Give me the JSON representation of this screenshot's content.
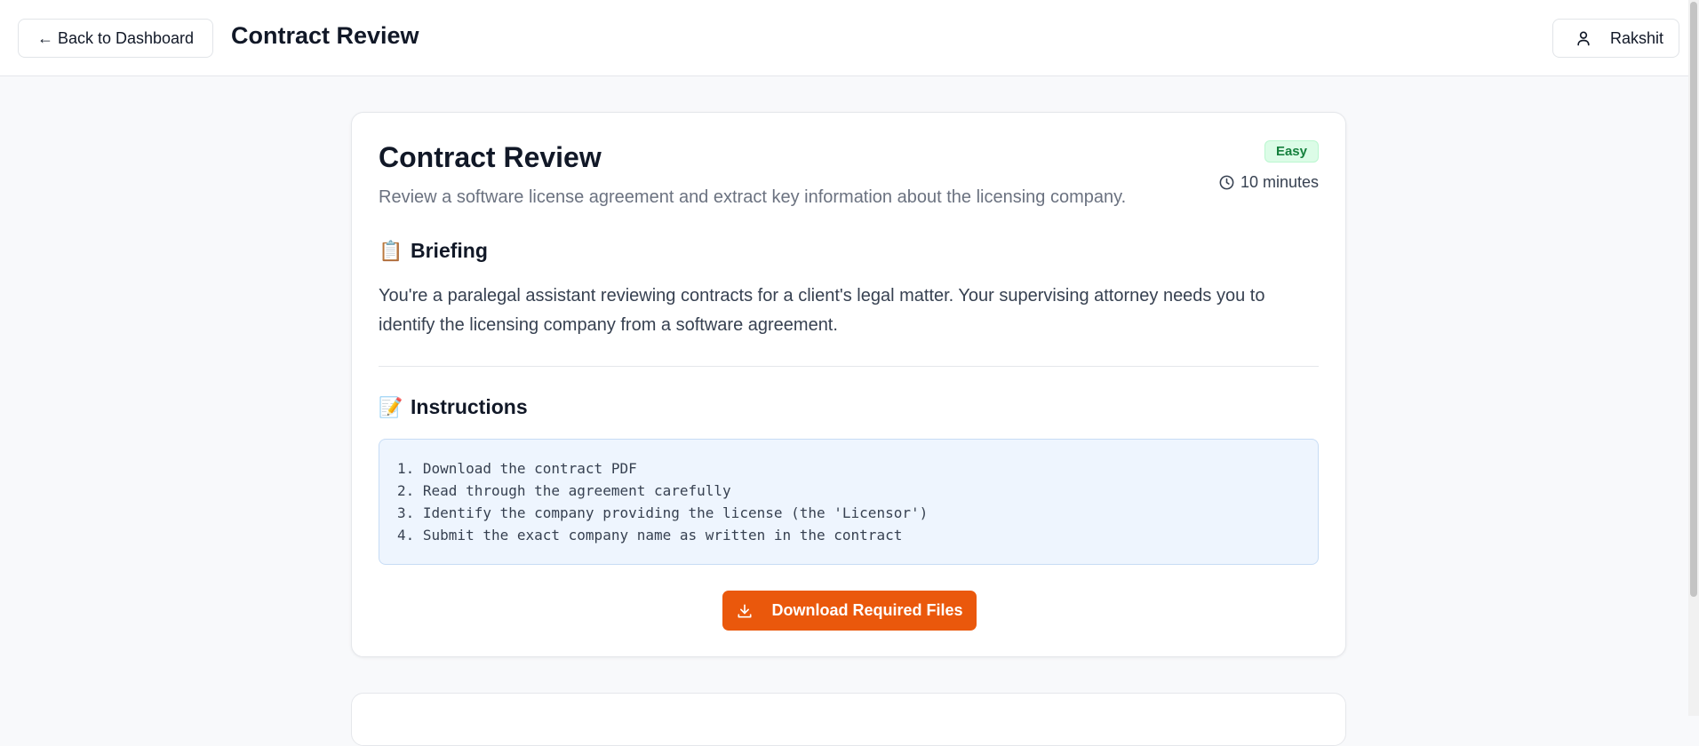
{
  "header": {
    "back_label": "← Back to Dashboard",
    "title": "Contract Review",
    "user_name": "Rakshit",
    "user_icon": "user-icon"
  },
  "task": {
    "title": "Contract Review",
    "description": "Review a software license agreement and extract key information about the licensing company.",
    "difficulty": "Easy",
    "duration": "10 minutes",
    "duration_icon": "clock-icon"
  },
  "briefing": {
    "emoji": "📋",
    "heading": "Briefing",
    "text": "You're a paralegal assistant reviewing contracts for a client's legal matter. Your supervising attorney needs you to identify the licensing company from a software agreement."
  },
  "instructions": {
    "emoji": "📝",
    "heading": "Instructions",
    "steps": [
      "1. Download the contract PDF",
      "2. Read through the agreement carefully",
      "3. Identify the company providing the license (the 'Licensor')",
      "4. Submit the exact company name as written in the contract"
    ]
  },
  "actions": {
    "download_label": "Download Required Files",
    "download_icon": "download-icon"
  },
  "colors": {
    "accent": "#ea580c",
    "badge_bg": "#dcfce7",
    "badge_text": "#15803d",
    "instructions_bg": "#eef5fe"
  }
}
